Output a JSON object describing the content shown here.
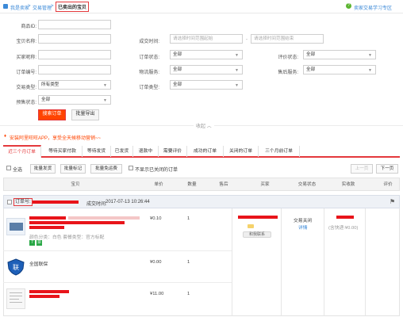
{
  "breadcrumb": {
    "home": "我是卖家",
    "sep1": ">",
    "section": "交易管理",
    "sep2": ">",
    "current": "已卖出的宝贝"
  },
  "help_link": "卖家交易学习专区",
  "filters": {
    "product_name": {
      "label": "商品ID:",
      "value": ""
    },
    "item_name": {
      "label": "宝贝名称:",
      "value": ""
    },
    "created_time": {
      "label": "成交时间:",
      "start_placeholder": "请选择时间范围起始",
      "dash": "-",
      "end_placeholder": "请选择时间范围结束"
    },
    "buyer_nick": {
      "label": "买家昵称:",
      "value": ""
    },
    "order_status": {
      "label": "订单状态:",
      "value": "全部"
    },
    "review_status": {
      "label": "评价状态:",
      "value": "全部"
    },
    "order_no": {
      "label": "订单编号:",
      "value": ""
    },
    "logistics": {
      "label": "物流服务:",
      "value": "全部"
    },
    "after_sale": {
      "label": "售后服务:",
      "value": "全部"
    },
    "trade_type": {
      "label": "交易类型:",
      "value": "所有类型"
    },
    "order_type": {
      "label": "订单类型:",
      "value": "全部"
    },
    "presale": {
      "label": "预售状态:",
      "value": "全部"
    }
  },
  "buttons": {
    "search": "搜索订单",
    "export": "批量导出",
    "collapse": "收起 ︿"
  },
  "promo": "安装阿里旺旺APP，享受全天候移动营销~~",
  "tabs": [
    "近三个月订单",
    "等待买家付款",
    "等待发货",
    "已发货",
    "退款中",
    "需要评价",
    "成功的订单",
    "关闭的订单",
    "三个月前订单"
  ],
  "bulk": {
    "select_all": "全选",
    "ship": "批量发货",
    "mark": "批量标记",
    "free_shipping": "批量免运费",
    "hide_closed": "不显示已关闭的订单",
    "prev": "上一页",
    "next": "下一页"
  },
  "columns": [
    "宝贝",
    "单价",
    "数量",
    "售后",
    "买家",
    "交易状态",
    "实收款",
    "评价"
  ],
  "order": {
    "no_label": "订单号:",
    "time_label": "成交时间:",
    "time_value": "2017-07-13 10:26:44",
    "status": "交易关闭",
    "detail_link": "详情",
    "shipping_note": "(含快递:¥0.00)",
    "contact_buyer": "和我联系",
    "items": [
      {
        "spec": "颜色分类：白色  套餐类型：官方标配",
        "price": "¥0.10",
        "qty": "1",
        "badge1": "7",
        "badge2": "票"
      },
      {
        "name": "全国联保",
        "price": "¥0.00",
        "qty": "1"
      },
      {
        "price": "¥11.00",
        "qty": "1"
      }
    ]
  },
  "colors": {
    "accent": "#e4393c",
    "orange": "#ff4400",
    "link": "#3c8ad8"
  },
  "icons": {
    "help": "question-circle-icon",
    "promo": "bell-icon",
    "flag": "flag-icon",
    "lian": "shield-icon"
  }
}
